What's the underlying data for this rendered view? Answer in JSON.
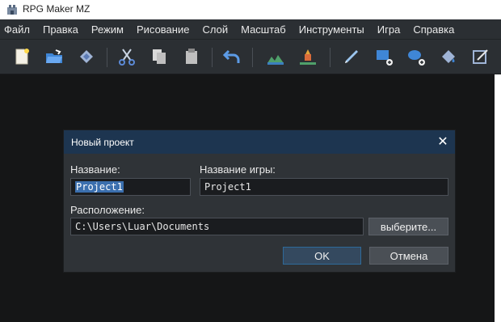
{
  "window": {
    "title": "RPG Maker MZ"
  },
  "menu": {
    "items": [
      "Файл",
      "Правка",
      "Режим",
      "Рисование",
      "Слой",
      "Масштаб",
      "Инструменты",
      "Игра",
      "Справка"
    ]
  },
  "toolbar": {
    "icons": [
      "new-project-icon",
      "open-project-icon",
      "save-project-icon",
      "cut-icon",
      "copy-icon",
      "paste-icon",
      "undo-icon",
      "map-layer-icon",
      "event-layer-icon",
      "pencil-icon",
      "rectangle-icon",
      "ellipse-icon",
      "fill-icon",
      "shadow-pen-icon"
    ]
  },
  "dialog": {
    "title": "Новый проект",
    "close_glyph": "✕",
    "name_label": "Название:",
    "name_value": "Project1",
    "game_title_label": "Название игры:",
    "game_title_value": "Project1",
    "location_label": "Расположение:",
    "location_value": "C:\\Users\\Luar\\Documents",
    "browse_label": "выберите...",
    "ok_label": "OK",
    "cancel_label": "Отмена"
  },
  "colors": {
    "menubar_bg": "#2b2f33",
    "workspace_bg": "#151617",
    "dialog_title_bg": "#1d3550",
    "selection": "#3b6fae"
  }
}
